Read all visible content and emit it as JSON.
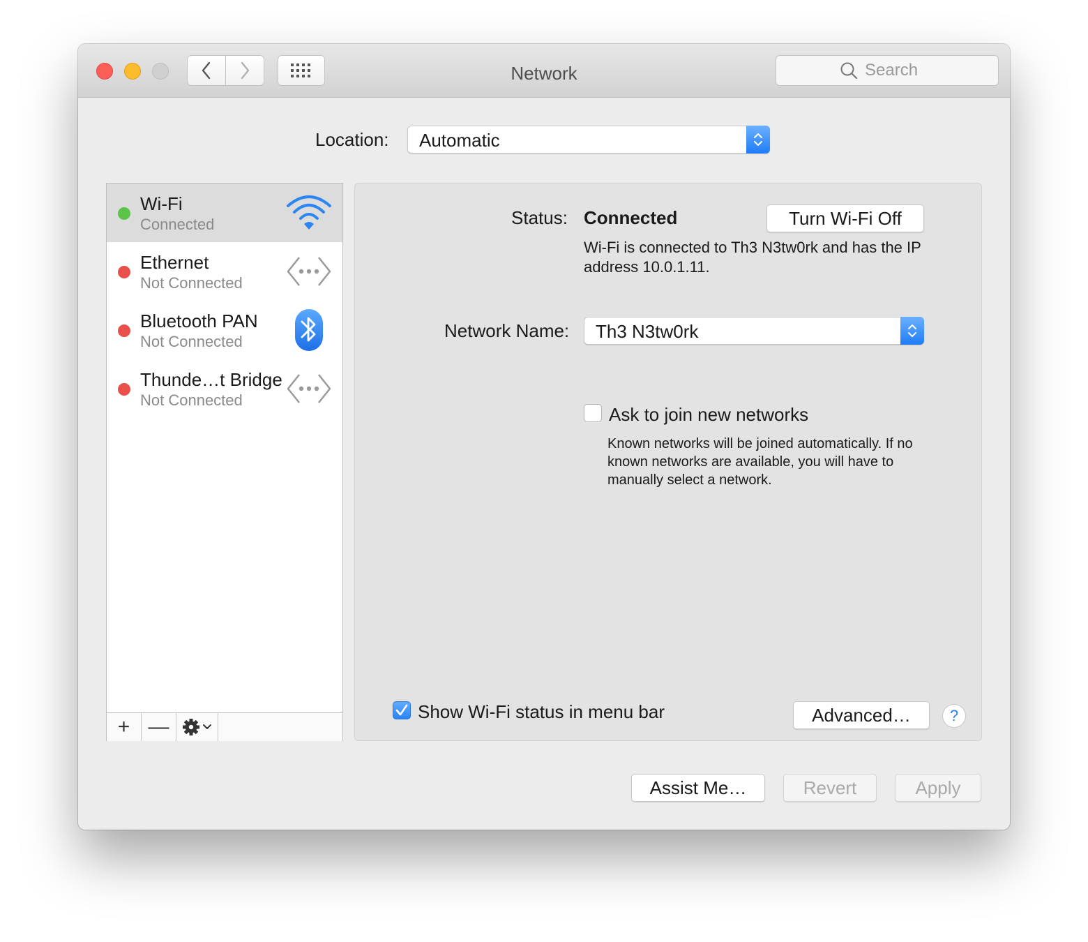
{
  "window": {
    "title": "Network",
    "search_placeholder": "Search",
    "icons": [
      "close-button",
      "minimize-button",
      "zoom-button",
      "chevron-left-icon",
      "chevron-right-icon",
      "grid-icon",
      "search-icon"
    ]
  },
  "location": {
    "label": "Location:",
    "value": "Automatic"
  },
  "services": [
    {
      "name": "Wi-Fi",
      "status": "Connected",
      "status_color": "#5ac348",
      "icon": "wifi-icon",
      "selected": true
    },
    {
      "name": "Ethernet",
      "status": "Not Connected",
      "status_color": "#e9504a",
      "icon": "ethernet-icon",
      "selected": false
    },
    {
      "name": "Bluetooth PAN",
      "status": "Not Connected",
      "status_color": "#e9504a",
      "icon": "bluetooth-icon",
      "selected": false
    },
    {
      "name": "Thunde…t Bridge",
      "status": "Not Connected",
      "status_color": "#e9504a",
      "icon": "ethernet-icon",
      "selected": false
    }
  ],
  "sidebar_toolbar": {
    "add": "+",
    "remove": "—"
  },
  "detail": {
    "status_label": "Status:",
    "status_value": "Connected",
    "turn_off_button": "Turn Wi-Fi Off",
    "status_description": "Wi-Fi is connected to Th3 N3tw0rk and has the IP address 10.0.1.11.",
    "network_name_label": "Network Name:",
    "network_name_value": "Th3 N3tw0rk",
    "ask_join_label": "Ask to join new networks",
    "ask_join_checked": false,
    "ask_join_description": "Known networks will be joined automatically. If no known networks are available, you will have to manually select a network.",
    "show_status_label": "Show Wi-Fi status in menu bar",
    "show_status_checked": true,
    "advanced_button": "Advanced…",
    "help": "?"
  },
  "footer": {
    "assist_button": "Assist Me…",
    "revert_button": "Revert",
    "apply_button": "Apply"
  },
  "colors": {
    "accent": "#1f7cf6",
    "connected": "#5ac348",
    "disconnected": "#e9504a"
  }
}
